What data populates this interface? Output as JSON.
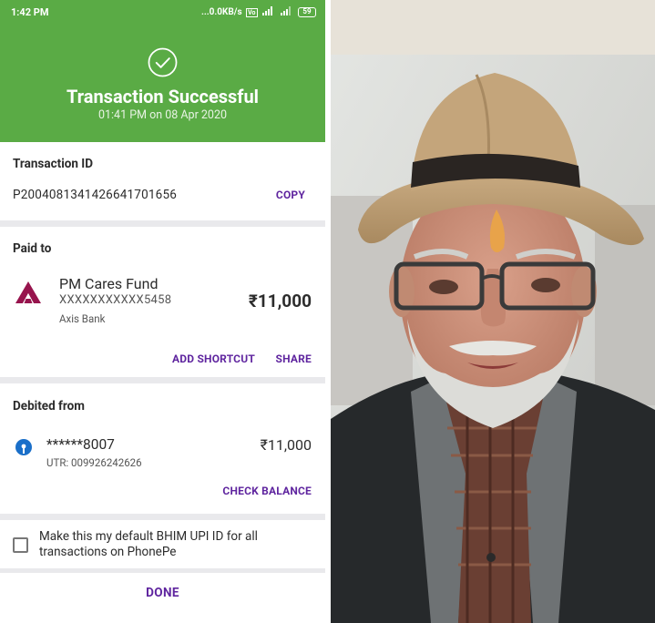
{
  "status_bar": {
    "time": "1:42 PM",
    "network_speed": "...0.0KB/s",
    "volte": "VoLTE",
    "signal": "4G",
    "battery": "59"
  },
  "header": {
    "title": "Transaction Successful",
    "timestamp": "01:41 PM on 08 Apr 2020",
    "bg_color": "#5aab45"
  },
  "transaction": {
    "label": "Transaction ID",
    "id": "P2004081341426641701656",
    "copy_label": "COPY"
  },
  "paid_to": {
    "label": "Paid to",
    "payee_name": "PM Cares Fund",
    "account": "XXXXXXXXXXX5458",
    "bank": "Axis Bank",
    "amount": "₹11,000",
    "add_shortcut_label": "ADD SHORTCUT",
    "share_label": "SHARE"
  },
  "debited_from": {
    "label": "Debited from",
    "account": "******8007",
    "utr": "UTR: 009926242626",
    "amount": "₹11,000",
    "check_balance_label": "CHECK BALANCE"
  },
  "default_upi": {
    "text": "Make this my default BHIM UPI ID for all transactions on PhonePe",
    "checked": false
  },
  "footer": {
    "done_label": "DONE"
  },
  "accent_color": "#5f259f"
}
